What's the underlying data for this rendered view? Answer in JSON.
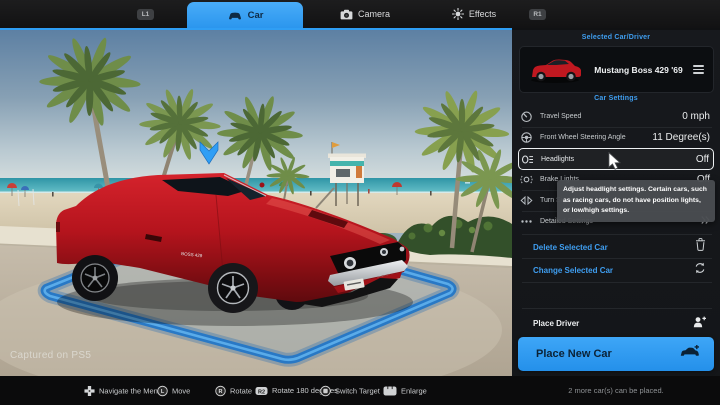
{
  "top_bar": {
    "left_bumper": "L1",
    "right_bumper": "R1",
    "tabs": [
      {
        "label": "Car",
        "active": true
      },
      {
        "label": "Camera",
        "active": false
      },
      {
        "label": "Effects",
        "active": false
      }
    ]
  },
  "scene": {
    "watermark": "Captured on PS5",
    "car_decal": "BOSS 429"
  },
  "panel": {
    "selected_header": "Selected Car/Driver",
    "car_name": "Mustang Boss 429 '69",
    "settings_header": "Car Settings",
    "settings": [
      {
        "label": "Travel Speed",
        "value": "0 mph"
      },
      {
        "label": "Front Wheel Steering Angle",
        "value": "11 Degree(s)"
      },
      {
        "label": "Headlights",
        "value": "Off"
      },
      {
        "label": "Brake Lights",
        "value": "Off"
      },
      {
        "label": "Turn Signals",
        "value": ""
      },
      {
        "label": "Detailed Settings",
        "value": ""
      }
    ],
    "tooltip": "Adjust headlight settings. Certain cars, such as racing cars, do not have position lights, or low/high settings.",
    "actions": [
      {
        "label": "Delete Selected Car"
      },
      {
        "label": "Change Selected Car"
      }
    ],
    "place_driver": "Place Driver",
    "place_new_car": "Place New Car",
    "footer_note": "2 more car(s) can be placed."
  },
  "bottom_bar": {
    "controls": [
      {
        "button": "",
        "label": "Navigate the Menu"
      },
      {
        "button": "L",
        "label": "Move"
      },
      {
        "button": "R",
        "label": "Rotate"
      },
      {
        "button": "R2",
        "label": "Rotate 180 degrees"
      },
      {
        "button": "",
        "label": "Switch Target"
      },
      {
        "button": "",
        "label": "Enlarge"
      }
    ]
  },
  "colors": {
    "accent_blue": "#2f9ef4",
    "header_blue": "#3f9ef0",
    "platform_blue": "#1e74c8"
  }
}
